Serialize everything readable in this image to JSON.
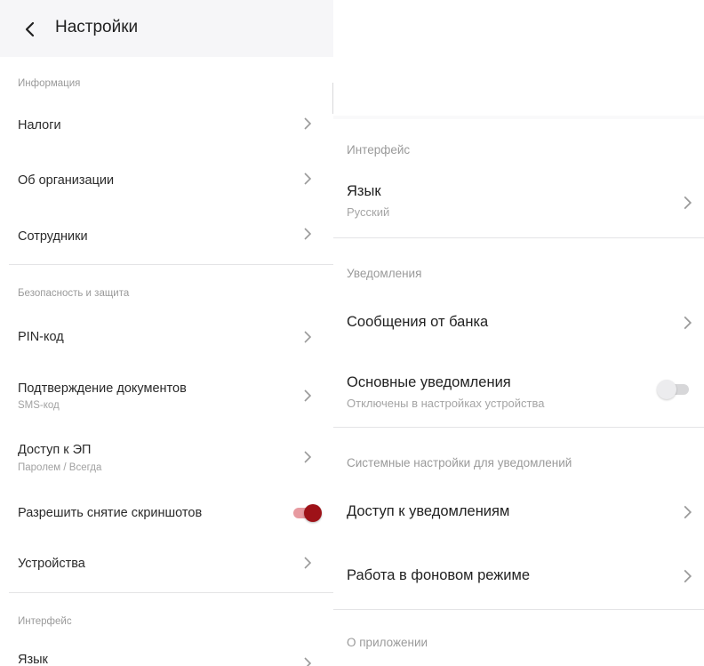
{
  "header": {
    "title": "Настройки",
    "back_icon": "chevron-left-icon"
  },
  "left": {
    "sections": {
      "info": "Информация",
      "security": "Безопасность и защита",
      "interface": "Интерфейс"
    },
    "items": {
      "taxes": "Налоги",
      "organization": "Об организации",
      "employees": "Сотрудники",
      "pin": "PIN-код",
      "doc_confirm": "Подтверждение документов",
      "doc_confirm_sub": "SMS-код",
      "ep_access": "Доступ к ЭП",
      "ep_access_sub": "Паролем / Всегда",
      "screenshots": "Разрешить снятие скриншотов",
      "devices": "Устройства",
      "language": "Язык"
    },
    "screenshots_enabled": true
  },
  "right": {
    "sections": {
      "interface": "Интерфейс",
      "notifications": "Уведомления",
      "system": "Системные настройки для уведомлений",
      "about": "О приложении"
    },
    "items": {
      "language": "Язык",
      "language_value": "Русский",
      "bank_messages": "Сообщения от банка",
      "main_notifications": "Основные уведомления",
      "main_notifications_sub": "Отключены в настройках устройства",
      "notification_access": "Доступ к уведомлениям",
      "background_mode": "Работа в фоновом режиме"
    },
    "main_notifications_enabled": false
  },
  "colors": {
    "accent": "#9e1218",
    "accent_track": "#e79aa0",
    "header_bg": "#f6f6f8",
    "divider": "#e4e4e6",
    "muted_text": "#9a9a9a"
  }
}
